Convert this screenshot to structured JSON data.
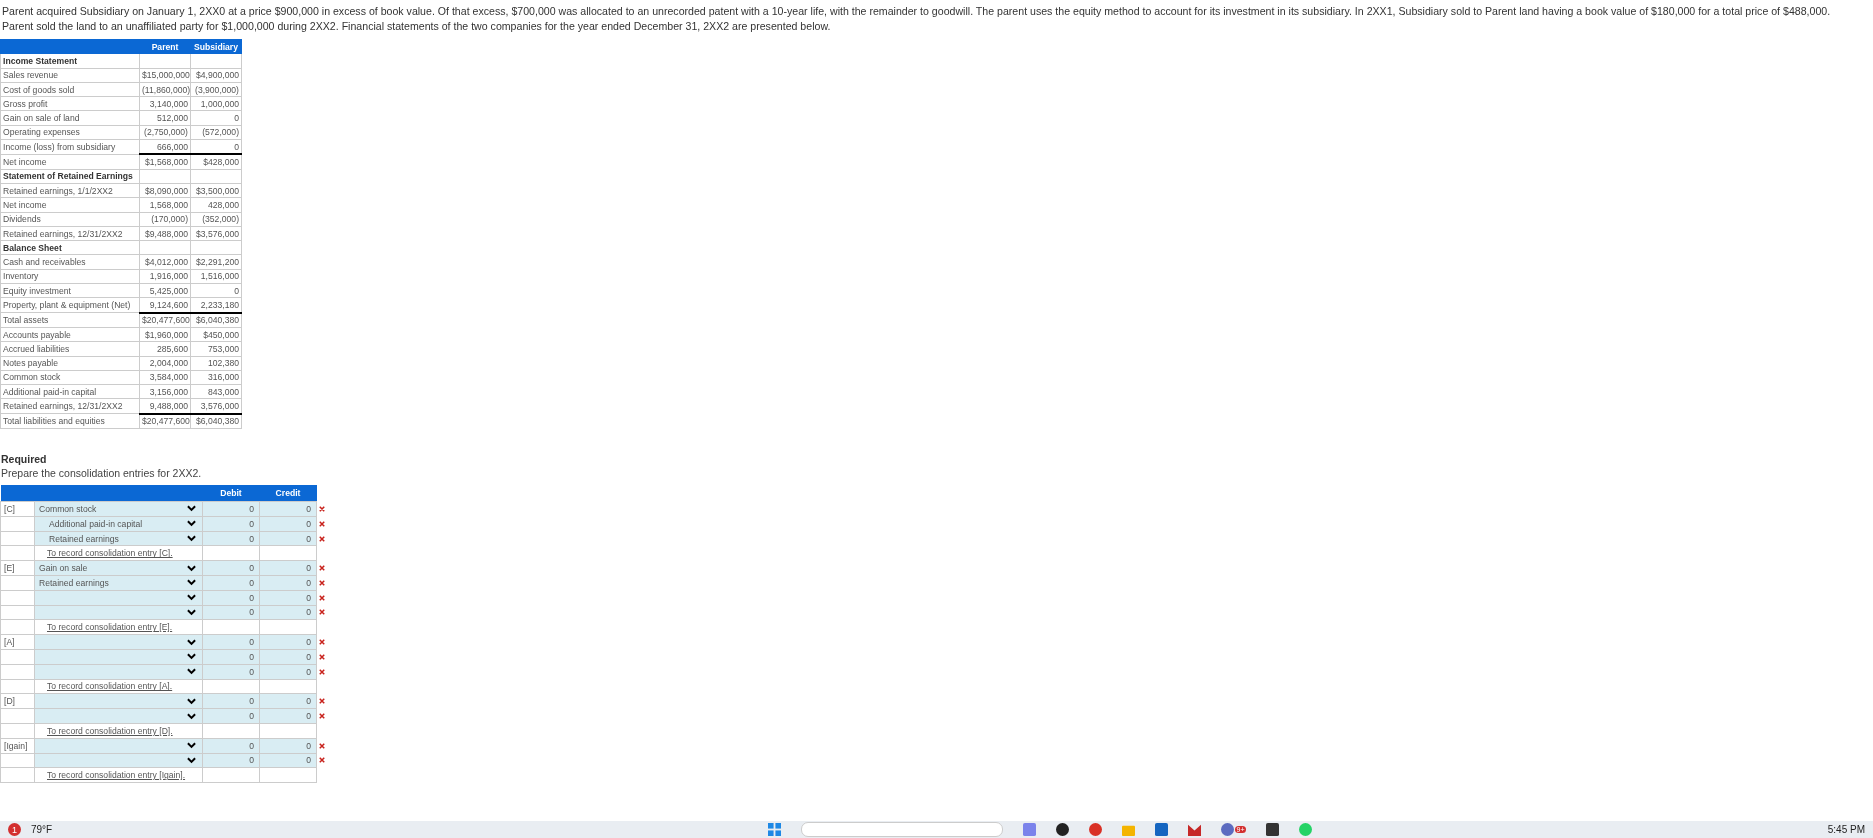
{
  "intro": "Parent acquired Subsidiary on January 1, 2XX0 at a price $900,000 in excess of book value. Of that excess, $700,000 was allocated to an unrecorded patent with a 10-year life, with the remainder to goodwill. The parent uses the equity method to account for its investment in its subsidiary. In 2XX1, Subsidiary sold to Parent land having a book value of $180,000 for a total price of $488,000. Parent sold the land to an unaffiliated party for $1,000,000 during 2XX2. Financial statements of the two companies for the year ended December 31, 2XX2 are presented below.",
  "statements": {
    "columns": [
      "Parent",
      "Subsidiary"
    ],
    "rows": [
      {
        "kind": "section",
        "label": "Income Statement"
      },
      {
        "kind": "line",
        "label": "Sales revenue",
        "parent": "$15,000,000",
        "subsidiary": "$4,900,000",
        "total": false
      },
      {
        "kind": "line",
        "label": "Cost of goods sold",
        "parent": "(11,860,000)",
        "subsidiary": "(3,900,000)",
        "total": false
      },
      {
        "kind": "line",
        "label": "Gross profit",
        "parent": "3,140,000",
        "subsidiary": "1,000,000",
        "total": false
      },
      {
        "kind": "line",
        "label": "Gain on sale of land",
        "parent": "512,000",
        "subsidiary": "0",
        "total": false
      },
      {
        "kind": "line",
        "label": "Operating expenses",
        "parent": "(2,750,000)",
        "subsidiary": "(572,000)",
        "total": false
      },
      {
        "kind": "line",
        "label": "Income (loss) from subsidiary",
        "parent": "666,000",
        "subsidiary": "0",
        "total": false
      },
      {
        "kind": "line",
        "label": "Net income",
        "parent": "$1,568,000",
        "subsidiary": "$428,000",
        "total": true
      },
      {
        "kind": "section",
        "label": "Statement of Retained Earnings"
      },
      {
        "kind": "line",
        "label": "Retained earnings, 1/1/2XX2",
        "parent": "$8,090,000",
        "subsidiary": "$3,500,000",
        "total": false
      },
      {
        "kind": "line",
        "label": "Net income",
        "parent": "1,568,000",
        "subsidiary": "428,000",
        "total": false
      },
      {
        "kind": "line",
        "label": "Dividends",
        "parent": "(170,000)",
        "subsidiary": "(352,000)",
        "total": false
      },
      {
        "kind": "line",
        "label": "Retained earnings, 12/31/2XX2",
        "parent": "$9,488,000",
        "subsidiary": "$3,576,000",
        "total": false
      },
      {
        "kind": "section",
        "label": "Balance Sheet"
      },
      {
        "kind": "line",
        "label": "Cash and receivables",
        "parent": "$4,012,000",
        "subsidiary": "$2,291,200",
        "total": false
      },
      {
        "kind": "line",
        "label": "Inventory",
        "parent": "1,916,000",
        "subsidiary": "1,516,000",
        "total": false
      },
      {
        "kind": "line",
        "label": "Equity investment",
        "parent": "5,425,000",
        "subsidiary": "0",
        "total": false
      },
      {
        "kind": "line",
        "label": "Property, plant & equipment (Net)",
        "parent": "9,124,600",
        "subsidiary": "2,233,180",
        "total": false
      },
      {
        "kind": "line",
        "label": "Total assets",
        "parent": "$20,477,600",
        "subsidiary": "$6,040,380",
        "total": true
      },
      {
        "kind": "line",
        "label": "Accounts payable",
        "parent": "$1,960,000",
        "subsidiary": "$450,000",
        "total": false
      },
      {
        "kind": "line",
        "label": "Accrued liabilities",
        "parent": "285,600",
        "subsidiary": "753,000",
        "total": false
      },
      {
        "kind": "line",
        "label": "Notes payable",
        "parent": "2,004,000",
        "subsidiary": "102,380",
        "total": false
      },
      {
        "kind": "line",
        "label": "Common stock",
        "parent": "3,584,000",
        "subsidiary": "316,000",
        "total": false
      },
      {
        "kind": "line",
        "label": "Additional paid-in capital",
        "parent": "3,156,000",
        "subsidiary": "843,000",
        "total": false
      },
      {
        "kind": "line",
        "label": "Retained earnings, 12/31/2XX2",
        "parent": "9,488,000",
        "subsidiary": "3,576,000",
        "total": false
      },
      {
        "kind": "line",
        "label": "Total liabilities and equities",
        "parent": "$20,477,600",
        "subsidiary": "$6,040,380",
        "total": true
      }
    ]
  },
  "required": {
    "heading": "Required",
    "instruction": "Prepare the consolidation entries for 2XX2."
  },
  "journal": {
    "columns": [
      "Debit",
      "Credit"
    ],
    "entries": [
      {
        "ref": "[C]",
        "memo": "To record consolidation entry [C].",
        "lines": [
          {
            "account": "Common stock",
            "indented": false,
            "debit": "0",
            "credit": "0",
            "wrong": true
          },
          {
            "account": "Additional paid-in capital",
            "indented": true,
            "debit": "0",
            "credit": "0",
            "wrong": true
          },
          {
            "account": "Retained earnings",
            "indented": true,
            "debit": "0",
            "credit": "0",
            "wrong": true
          }
        ]
      },
      {
        "ref": "[E]",
        "memo": "To record consolidation entry [E].",
        "lines": [
          {
            "account": "Gain on sale",
            "indented": false,
            "debit": "0",
            "credit": "0",
            "wrong": true
          },
          {
            "account": "Retained earnings",
            "indented": false,
            "debit": "0",
            "credit": "0",
            "wrong": true
          },
          {
            "debit": "0",
            "credit": "0",
            "wrong": true
          },
          {
            "debit": "0",
            "credit": "0",
            "wrong": true
          }
        ]
      },
      {
        "ref": "[A]",
        "memo": "To record consolidation entry [A].",
        "lines": [
          {
            "debit": "0",
            "credit": "0",
            "wrong": true
          },
          {
            "debit": "0",
            "credit": "0",
            "wrong": true
          },
          {
            "debit": "0",
            "credit": "0",
            "wrong": true
          }
        ]
      },
      {
        "ref": "[D]",
        "memo": "To record consolidation entry [D].",
        "lines": [
          {
            "debit": "0",
            "credit": "0",
            "wrong": true
          },
          {
            "debit": "0",
            "credit": "0",
            "wrong": true
          }
        ]
      },
      {
        "ref": "[Igain]",
        "memo": "To record consolidation entry [Igain].",
        "lines": [
          {
            "debit": "0",
            "credit": "0",
            "wrong": true
          },
          {
            "debit": "0",
            "credit": "0",
            "wrong": true
          }
        ]
      }
    ]
  },
  "taskbar": {
    "weather_badge": "1",
    "temperature": "79°F",
    "time": "5:45 PM",
    "notification_badge": "9+"
  }
}
